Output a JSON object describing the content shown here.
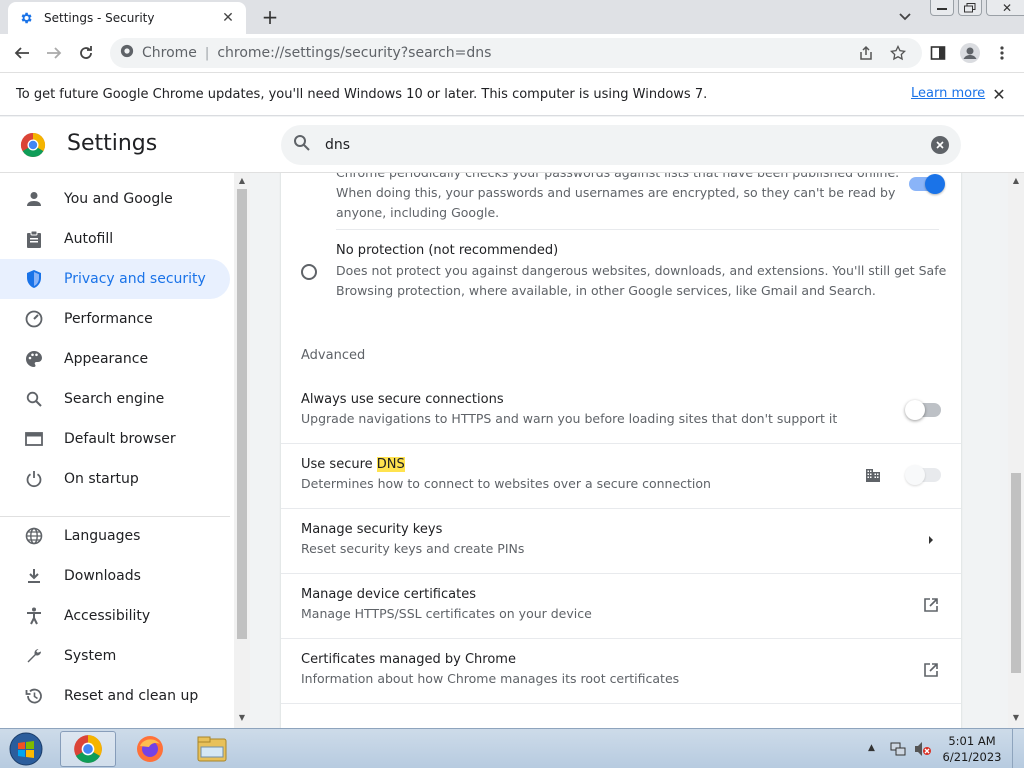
{
  "browser": {
    "tab_title": "Settings - Security",
    "omnibox_site": "Chrome",
    "omnibox_url": "chrome://settings/security?search=dns"
  },
  "infobar": {
    "message": "To get future Google Chrome updates, you'll need Windows 10 or later. This computer is using Windows 7.",
    "learn_more": "Learn more"
  },
  "settings": {
    "title": "Settings",
    "search_value": "dns",
    "sidebar": [
      {
        "label": "You and Google",
        "icon": "person-icon"
      },
      {
        "label": "Autofill",
        "icon": "clipboard-icon"
      },
      {
        "label": "Privacy and security",
        "icon": "shield-icon",
        "active": true
      },
      {
        "label": "Performance",
        "icon": "speedometer-icon"
      },
      {
        "label": "Appearance",
        "icon": "palette-icon"
      },
      {
        "label": "Search engine",
        "icon": "search-icon"
      },
      {
        "label": "Default browser",
        "icon": "browser-icon"
      },
      {
        "label": "On startup",
        "icon": "power-icon"
      },
      {
        "label": "Languages",
        "icon": "globe-icon"
      },
      {
        "label": "Downloads",
        "icon": "download-icon"
      },
      {
        "label": "Accessibility",
        "icon": "accessibility-icon"
      },
      {
        "label": "System",
        "icon": "wrench-icon"
      },
      {
        "label": "Reset and clean up",
        "icon": "history-icon"
      }
    ]
  },
  "content": {
    "password_partial_line": "Chrome periodically checks your passwords against lists that have been published online.",
    "password_desc_2": "When doing this, your passwords and usernames are encrypted, so they can't be read by",
    "password_desc_3": "anyone, including Google.",
    "no_protection_title": "No protection (not recommended)",
    "no_protection_desc_1": "Does not protect you against dangerous websites, downloads, and extensions. You'll still get Safe",
    "no_protection_desc_2": "Browsing protection, where available, in other Google services, like Gmail and Search.",
    "advanced_heading": "Advanced",
    "https_title": "Always use secure connections",
    "https_desc": "Upgrade navigations to HTTPS and warn you before loading sites that don't support it",
    "dns_title_prefix": "Use secure ",
    "dns_title_highlight": "DNS",
    "dns_desc": "Determines how to connect to websites over a secure connection",
    "keys_title": "Manage security keys",
    "keys_desc": "Reset security keys and create PINs",
    "certs_title": "Manage device certificates",
    "certs_desc": "Manage HTTPS/SSL certificates on your device",
    "chrome_certs_title": "Certificates managed by Chrome",
    "chrome_certs_desc": "Information about how Chrome manages its root certificates"
  },
  "taskbar": {
    "time": "5:01 AM",
    "date": "6/21/2023"
  },
  "colors": {
    "accent": "#1a73e8",
    "active_bg": "#e8f0fe",
    "highlight": "#ffe34f"
  }
}
